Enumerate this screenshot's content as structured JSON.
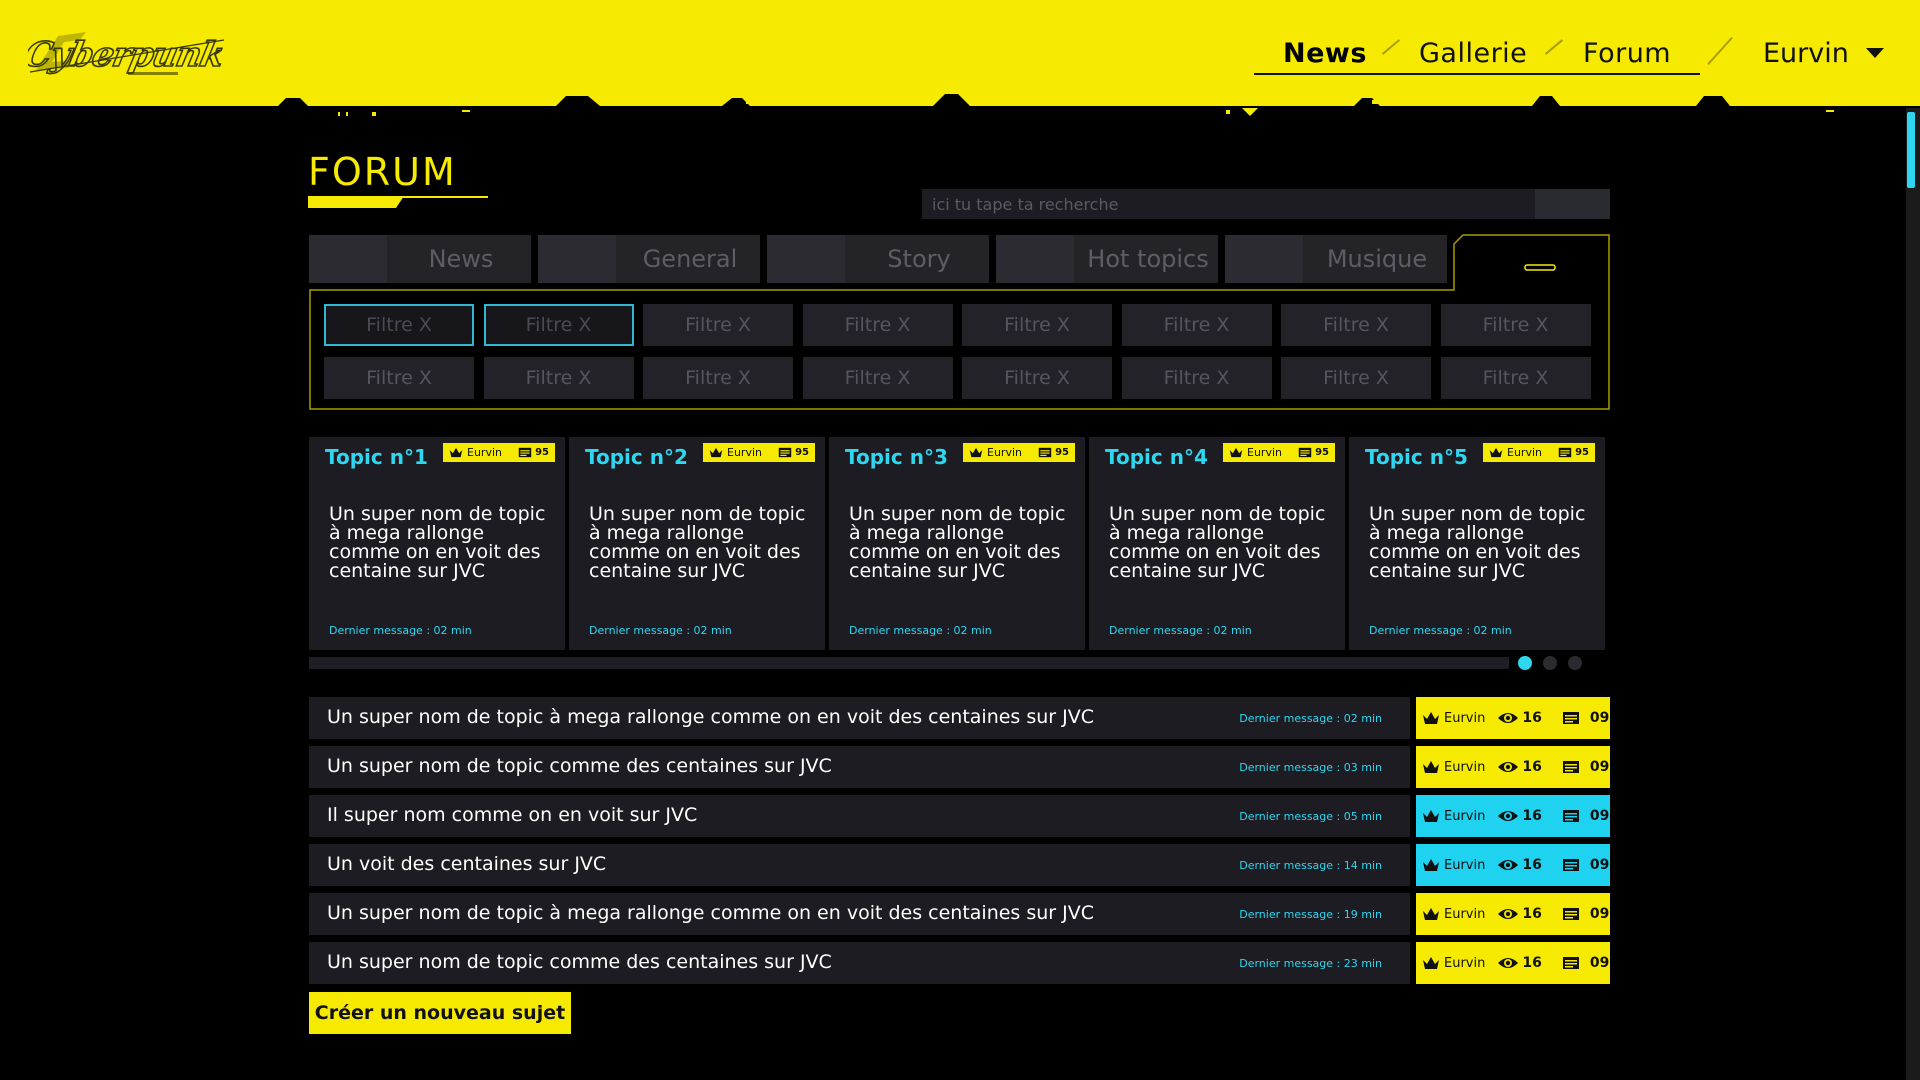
{
  "header": {
    "logo_text": "CYBERPUNK",
    "nav": [
      {
        "label": "News",
        "active": true
      },
      {
        "label": "Gallerie",
        "active": false
      },
      {
        "label": "Forum",
        "active": false
      }
    ],
    "user": {
      "name": "Eurvin",
      "caret_icon": "caret-down-icon"
    }
  },
  "page": {
    "title": "FORUM"
  },
  "search": {
    "placeholder": "ici tu tape ta recherche"
  },
  "tabs": [
    {
      "label": "News"
    },
    {
      "label": "General"
    },
    {
      "label": "Story"
    },
    {
      "label": "Hot topics"
    },
    {
      "label": "Musique"
    }
  ],
  "filters": [
    {
      "label": "Filtre X",
      "selected": true
    },
    {
      "label": "Filtre X",
      "selected": true
    },
    {
      "label": "Filtre X",
      "selected": false
    },
    {
      "label": "Filtre X",
      "selected": false
    },
    {
      "label": "Filtre X",
      "selected": false
    },
    {
      "label": "Filtre X",
      "selected": false
    },
    {
      "label": "Filtre X",
      "selected": false
    },
    {
      "label": "Filtre X",
      "selected": false
    },
    {
      "label": "Filtre X",
      "selected": false
    },
    {
      "label": "Filtre X",
      "selected": false
    },
    {
      "label": "Filtre X",
      "selected": false
    },
    {
      "label": "Filtre X",
      "selected": false
    },
    {
      "label": "Filtre X",
      "selected": false
    },
    {
      "label": "Filtre X",
      "selected": false
    },
    {
      "label": "Filtre X",
      "selected": false
    },
    {
      "label": "Filtre X",
      "selected": false
    }
  ],
  "cards": [
    {
      "title": "Topic n°1",
      "author": "Eurvin",
      "count": "95",
      "text": "Un super nom de topic à mega rallonge comme on en voit des centaine sur JVC",
      "meta": "Dernier message : 02 min"
    },
    {
      "title": "Topic n°2",
      "author": "Eurvin",
      "count": "95",
      "text": "Un super nom de topic à mega rallonge comme on en voit des centaine sur JVC",
      "meta": "Dernier message : 02 min"
    },
    {
      "title": "Topic n°3",
      "author": "Eurvin",
      "count": "95",
      "text": "Un super nom de topic à mega rallonge comme on en voit des centaine sur JVC",
      "meta": "Dernier message : 02 min"
    },
    {
      "title": "Topic n°4",
      "author": "Eurvin",
      "count": "95",
      "text": "Un super nom de topic à mega rallonge comme on en voit des centaine sur JVC",
      "meta": "Dernier message : 02 min"
    },
    {
      "title": "Topic n°5",
      "author": "Eurvin",
      "count": "95",
      "text": "Un super nom de topic à mega rallonge comme on en voit des centaine sur JVC",
      "meta": "Dernier message : 02 min"
    }
  ],
  "carousel": {
    "page_count": 3,
    "active_page": 1
  },
  "topics": [
    {
      "title": "Un super nom de topic à mega rallonge comme on en voit des centaines sur JVC",
      "meta": "Dernier message : 02 min",
      "author": "Eurvin",
      "views": "16",
      "messages": "09",
      "color": "#f5ea00"
    },
    {
      "title": "Un super nom de topic comme des centaines sur JVC",
      "meta": "Dernier message : 03 min",
      "author": "Eurvin",
      "views": "16",
      "messages": "09",
      "color": "#f5ea00"
    },
    {
      "title": "Il super nom  comme on en voit sur JVC",
      "meta": "Dernier message : 05 min",
      "author": "Eurvin",
      "views": "16",
      "messages": "09",
      "color": "#1fd2ef"
    },
    {
      "title": "Un voit des centaines sur JVC",
      "meta": "Dernier message : 14 min",
      "author": "Eurvin",
      "views": "16",
      "messages": "09",
      "color": "#1fd2ef"
    },
    {
      "title": "Un super nom de topic à mega rallonge comme on en voit des centaines sur JVC",
      "meta": "Dernier message : 19 min",
      "author": "Eurvin",
      "views": "16",
      "messages": "09",
      "color": "#f5ea00"
    },
    {
      "title": "Un super nom de topic comme des centaines sur JVC",
      "meta": "Dernier message : 23 min",
      "author": "Eurvin",
      "views": "16",
      "messages": "09",
      "color": "#f5ea00"
    }
  ],
  "create_button": {
    "label": "Créer un nouveau sujet"
  },
  "colors": {
    "accent_yellow": "#f5ea00",
    "accent_cyan": "#2fd6f0",
    "background": "#000000",
    "panel": "#1c1c22"
  },
  "icons": {
    "crown": "crown-icon",
    "eye": "eye-icon",
    "messages": "message-icon",
    "logo": "cyberpunk-logo"
  }
}
